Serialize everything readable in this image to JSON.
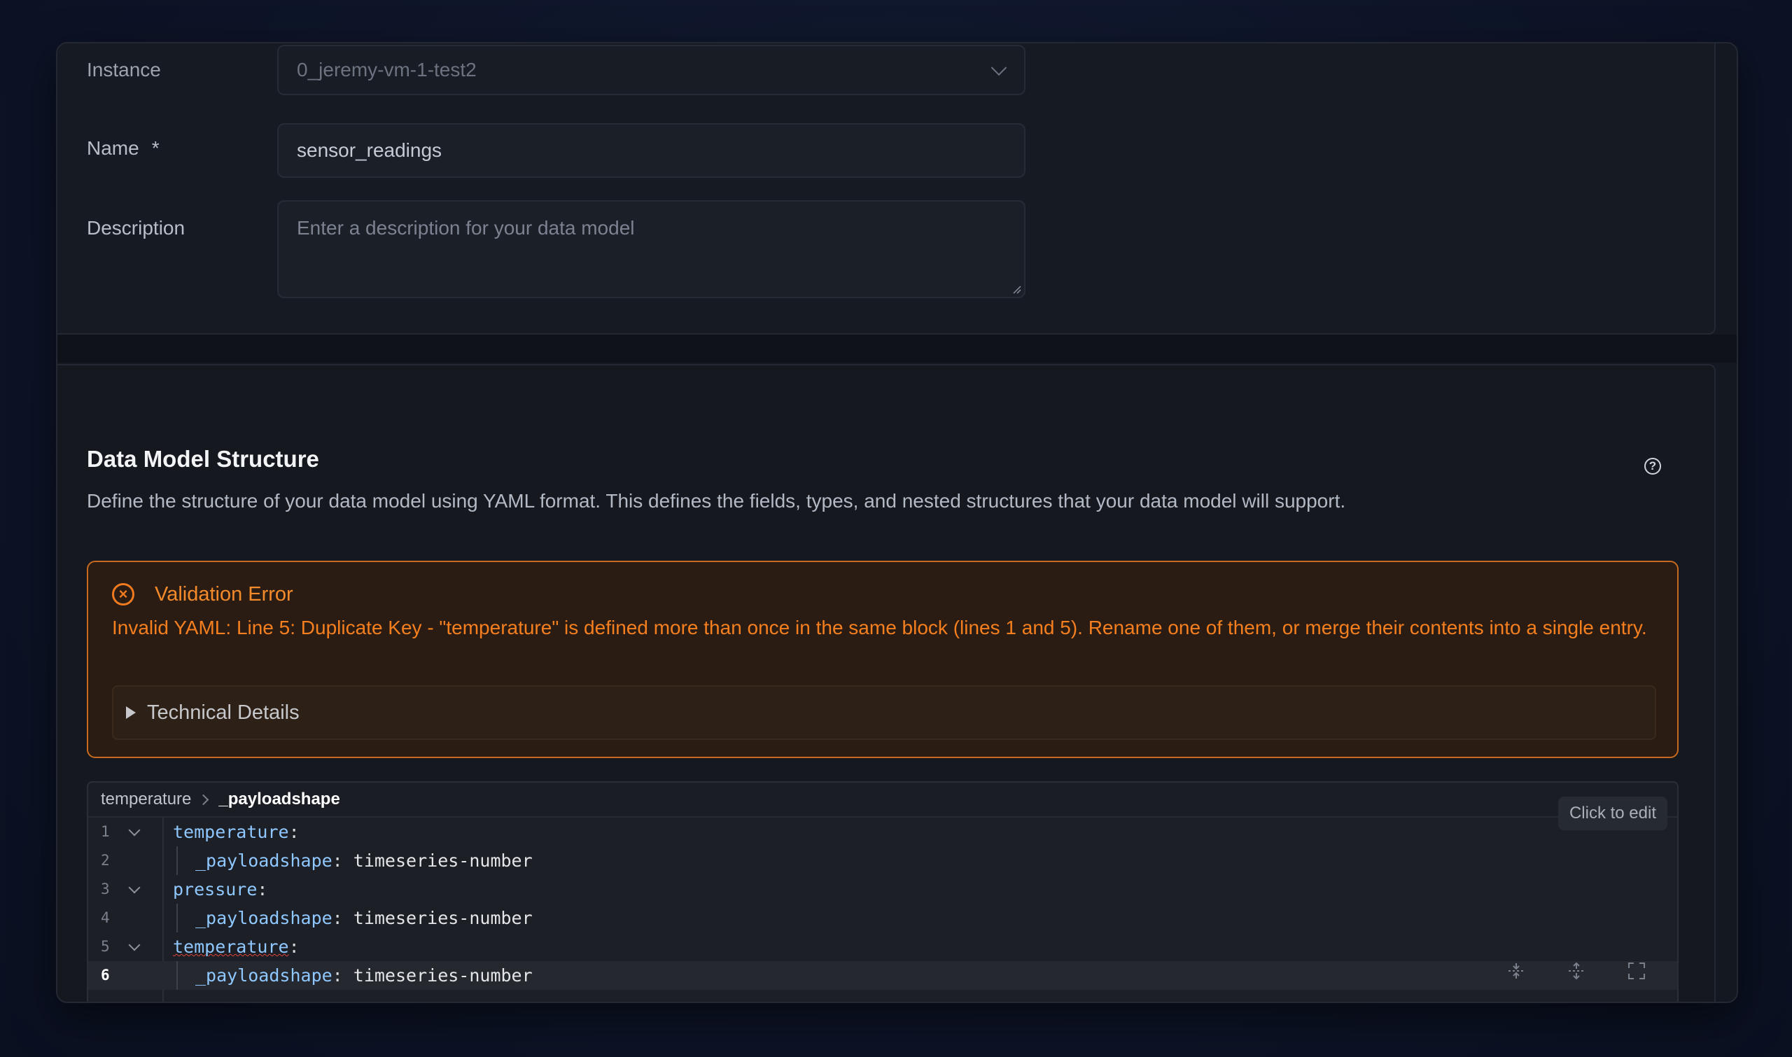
{
  "form": {
    "instance": {
      "label": "Instance",
      "value": "0_jeremy-vm-1-test2"
    },
    "name": {
      "label": "Name",
      "required_mark": "*",
      "value": "sensor_readings"
    },
    "description": {
      "label": "Description",
      "placeholder": "Enter a description for your data model",
      "value": ""
    }
  },
  "structure": {
    "title": "Data Model Structure",
    "description": "Define the structure of your data model using YAML format. This defines the fields, types, and nested structures that your data model will support.",
    "help_icon": "question-circle-icon"
  },
  "error": {
    "title": "Validation Error",
    "message": "Invalid YAML: Line 5: Duplicate Key - \"temperature\" is defined more than once in the same block (lines 1 and 5). Rename one of them, or merge their contents into a single entry.",
    "details_label": "Technical Details",
    "icon": "x-circle-icon",
    "color": "#f57f1f"
  },
  "editor": {
    "breadcrumb": [
      "temperature",
      "_payloadshape"
    ],
    "click_to_edit": "Click to edit",
    "lines": [
      {
        "num": "1",
        "key": "temperature",
        "punct": ":",
        "value": ""
      },
      {
        "num": "2",
        "key": "_payloadshape",
        "punct": ": ",
        "value": "timeseries-number"
      },
      {
        "num": "3",
        "key": "pressure",
        "punct": ":",
        "value": ""
      },
      {
        "num": "4",
        "key": "_payloadshape",
        "punct": ": ",
        "value": "timeseries-number"
      },
      {
        "num": "5",
        "key": "temperature",
        "punct": ":",
        "value": ""
      },
      {
        "num": "6",
        "key": "_payloadshape",
        "punct": ": ",
        "value": "timeseries-number"
      }
    ],
    "toolbar_icons": [
      "collapse-all-icon",
      "expand-all-icon",
      "fullscreen-icon"
    ]
  }
}
